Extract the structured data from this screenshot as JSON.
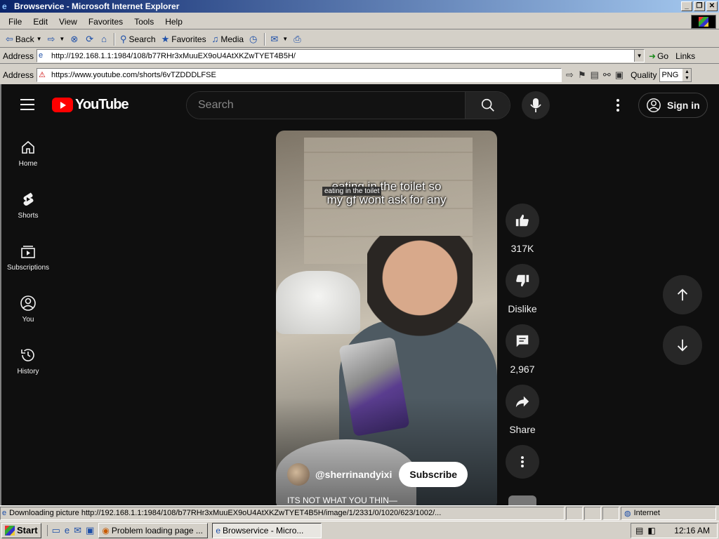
{
  "window": {
    "title": "Browservice - Microsoft Internet Explorer",
    "controls": [
      "_",
      "❐",
      "✕"
    ]
  },
  "menu": [
    "File",
    "Edit",
    "View",
    "Favorites",
    "Tools",
    "Help"
  ],
  "toolbar": {
    "back": "Back",
    "search": "Search",
    "favorites": "Favorites",
    "media": "Media"
  },
  "address_bar": {
    "label": "Address",
    "url": "http://192.168.1.1:1984/108/b77RHr3xMuuEX9oU4AtXKZwTYET4B5H/",
    "go": "Go",
    "links": "Links"
  },
  "inner_address_bar": {
    "label": "Address",
    "url": "https://www.youtube.com/shorts/6vTZDDDLFSE",
    "quality_label": "Quality",
    "quality_value": "PNG"
  },
  "youtube": {
    "logo_text": "YouTube",
    "search_placeholder": "Search",
    "sign_in": "Sign in",
    "sidebar": [
      {
        "label": "Home",
        "icon": "home-icon"
      },
      {
        "label": "Shorts",
        "icon": "shorts-icon"
      },
      {
        "label": "Subscriptions",
        "icon": "subscriptions-icon"
      },
      {
        "label": "You",
        "icon": "you-icon"
      },
      {
        "label": "History",
        "icon": "history-icon"
      }
    ],
    "video": {
      "caption_line1": "eating in the toilet so",
      "caption_line2": "my gf wont ask for any",
      "tooltip": "eating in the toilet",
      "channel": "@sherrinandyixi",
      "subscribe": "Subscribe",
      "description": "ITS NOT WHAT YOU THIN—"
    },
    "actions": {
      "likes": "317K",
      "dislike": "Dislike",
      "comments": "2,967",
      "share": "Share"
    }
  },
  "status_bar": {
    "text": "Downloading picture http://192.168.1.1:1984/108/b77RHr3xMuuEX9oU4AtXKZwTYET4B5H/image/1/2331/0/1020/623/1002/...",
    "zone": "Internet"
  },
  "taskbar": {
    "start": "Start",
    "tasks": [
      "Problem loading page ...",
      "Browservice - Micro..."
    ],
    "clock": "12:16 AM"
  }
}
